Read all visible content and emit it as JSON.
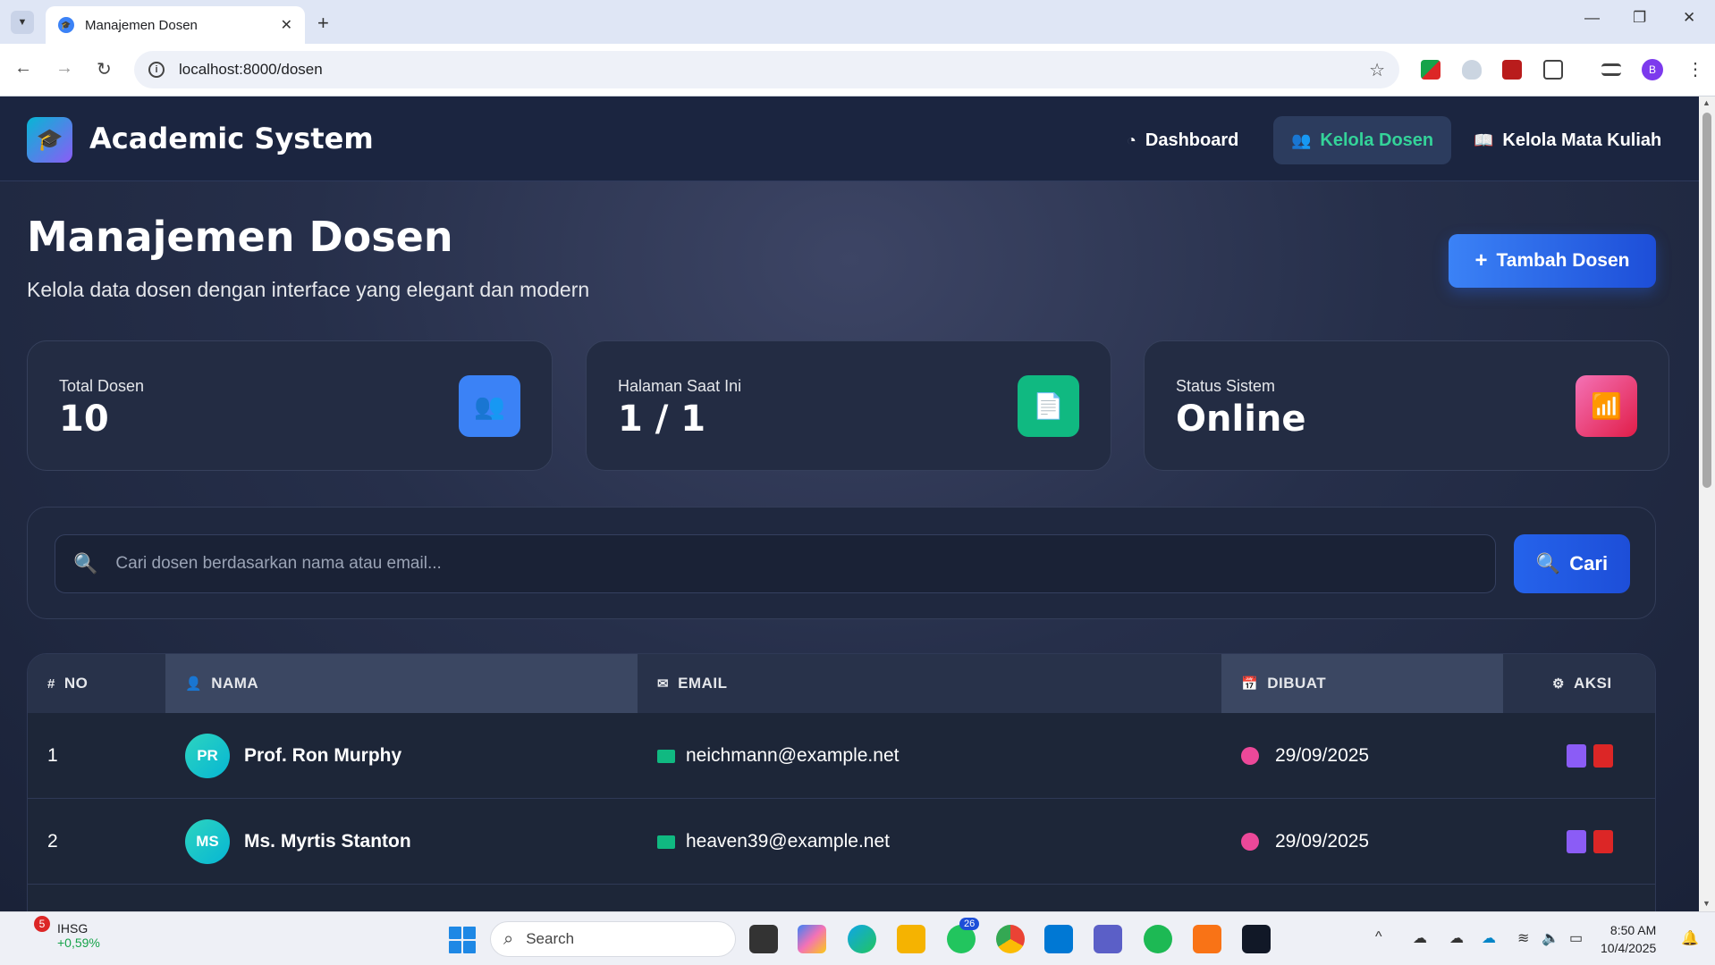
{
  "browser": {
    "tab_title": "Manajemen Dosen",
    "url": "localhost:8000/dosen",
    "profile_initial": "B"
  },
  "navbar": {
    "brand": "Academic System",
    "items": [
      {
        "label": "Dashboard",
        "icon": "dashboard-icon",
        "active": false
      },
      {
        "label": "Kelola Dosen",
        "icon": "users-icon",
        "active": true
      },
      {
        "label": "Kelola Mata Kuliah",
        "icon": "book-icon",
        "active": false
      }
    ]
  },
  "header": {
    "title": "Manajemen Dosen",
    "subtitle": "Kelola data dosen dengan interface yang elegant dan modern",
    "add_button": "Tambah Dosen"
  },
  "stats": [
    {
      "label": "Total Dosen",
      "value": "10",
      "icon": "users-icon",
      "color": "#3b82f6"
    },
    {
      "label": "Halaman Saat Ini",
      "value": "1 / 1",
      "icon": "file-icon",
      "color": "#10b981"
    },
    {
      "label": "Status Sistem",
      "value": "Online",
      "icon": "signal-icon",
      "color": "#ec4899"
    }
  ],
  "search": {
    "placeholder": "Cari dosen berdasarkan nama atau email...",
    "button": "Cari"
  },
  "table": {
    "headers": [
      "NO",
      "NAMA",
      "EMAIL",
      "DIBUAT",
      "AKSI"
    ],
    "rows": [
      {
        "no": "1",
        "initials": "PR",
        "name": "Prof. Ron Murphy",
        "email": "neichmann@example.net",
        "created": "29/09/2025"
      },
      {
        "no": "2",
        "initials": "MS",
        "name": "Ms. Myrtis Stanton",
        "email": "heaven39@example.net",
        "created": "29/09/2025"
      }
    ]
  },
  "taskbar": {
    "ticker": "IHSG",
    "ticker_change": "+0,59%",
    "ticker_badge": "5",
    "search": "Search",
    "whatsapp_badge": "26",
    "time": "8:50 AM",
    "date": "10/4/2025"
  }
}
